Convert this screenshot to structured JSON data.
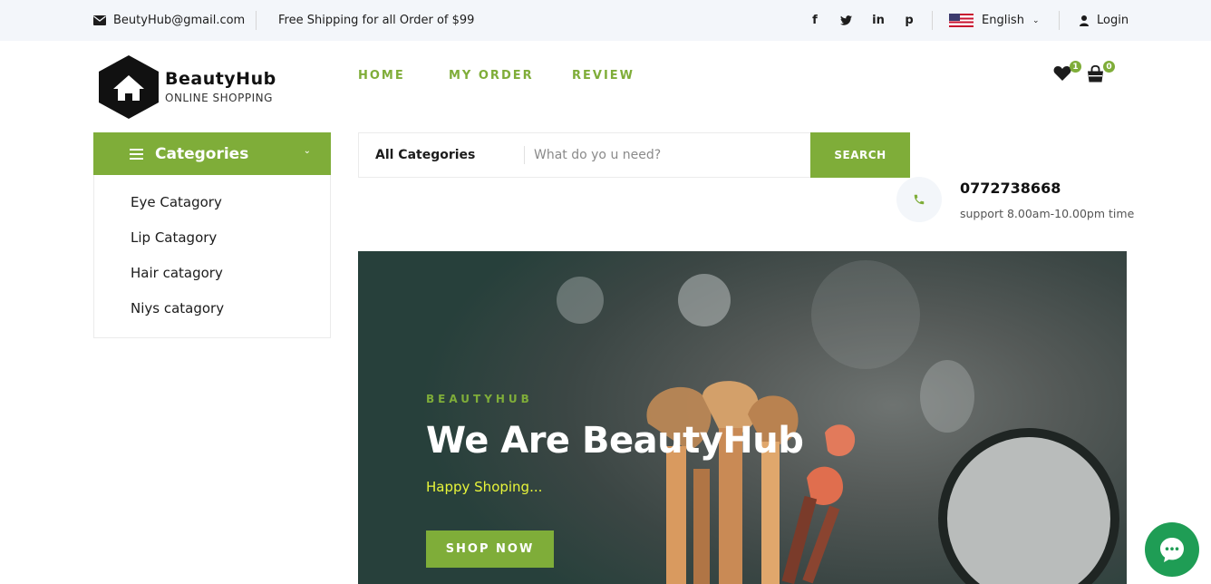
{
  "topbar": {
    "email": "BeutyHub@gmail.com",
    "shipping": "Free Shipping for all Order of $99",
    "social": [
      "f",
      "t",
      "in",
      "p"
    ],
    "language": "English",
    "login": "Login"
  },
  "brand": {
    "name": "BeautyHub",
    "tagline": "ONLINE SHOPPING"
  },
  "nav": [
    "HOME",
    "MY ORDER",
    "REVIEW"
  ],
  "header": {
    "wishlist_count": "1",
    "cart_count": "0"
  },
  "categories": {
    "title": "Categories",
    "items": [
      "Eye Catagory",
      "Lip Catagory",
      "Hair catagory",
      "Niys catagory"
    ]
  },
  "search": {
    "category": "All Categories",
    "placeholder": "What do yo u need?",
    "button": "SEARCH"
  },
  "contact": {
    "phone": "0772738668",
    "hours": "support 8.00am-10.00pm time"
  },
  "hero": {
    "eyebrow": "BEAUTYHUB",
    "headline": "We Are BeautyHub",
    "subtitle": "Happy Shoping...",
    "cta": "SHOP NOW"
  },
  "colors": {
    "accent": "#7fad39",
    "topbar_bg": "#f3f6fa",
    "chat": "#1f9d55",
    "hero_subtitle": "#e8f53a"
  },
  "icons": [
    "envelope-icon",
    "facebook-icon",
    "twitter-icon",
    "linkedin-icon",
    "pinterest-icon",
    "us-flag-icon",
    "chevron-down-icon",
    "user-icon",
    "home-icon",
    "heart-icon",
    "shopping-bag-icon",
    "menu-bars-icon",
    "phone-icon",
    "chat-icon"
  ]
}
